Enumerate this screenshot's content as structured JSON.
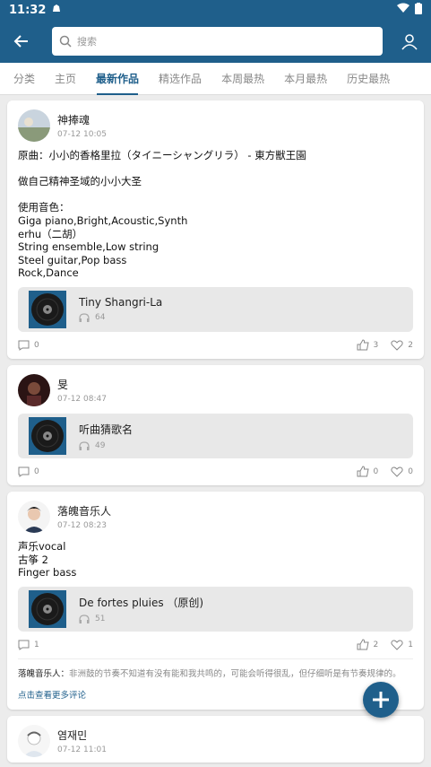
{
  "status": {
    "time": "11:32"
  },
  "search": {
    "placeholder": "搜索"
  },
  "tabs": [
    {
      "label": "分类"
    },
    {
      "label": "主页"
    },
    {
      "label": "最新作品",
      "active": true
    },
    {
      "label": "精选作品"
    },
    {
      "label": "本周最热"
    },
    {
      "label": "本月最热"
    },
    {
      "label": "历史最热"
    }
  ],
  "posts": [
    {
      "user": "神捧魂",
      "date": "07-12 10:05",
      "text": "原曲：小小的香格里拉（タイニーシャングリラ） - 東方獣王園\n\n做自己精神圣域的小小大圣\n\n使用音色：\nGiga piano,Bright,Acoustic,Synth\nerhu（二胡）\nString ensemble,Low string\nSteel guitar,Pop bass\nRock,Dance",
      "track": {
        "title": "Tiny Shangri-La",
        "plays": "64"
      },
      "comments": "0",
      "likes": "3",
      "favs": "2"
    },
    {
      "user": "旻",
      "date": "07-12 08:47",
      "text": "",
      "track": {
        "title": "听曲猜歌名",
        "plays": "49"
      },
      "comments": "0",
      "likes": "0",
      "favs": "0"
    },
    {
      "user": "落魄音乐人",
      "date": "07-12 08:23",
      "text": "声乐vocal\n古筝 2\nFinger bass",
      "track": {
        "title": "De fortes pluies （原创)",
        "plays": "51"
      },
      "comments": "1",
      "likes": "2",
      "favs": "1",
      "comment_preview": {
        "author": "落魄音乐人：",
        "text": "非洲鼓的节奏不知道有没有能和我共鸣的，可能会听得很乱，但仔细听是有节奏规律的。"
      },
      "more_comments": "点击查看更多评论"
    },
    {
      "user": "염재민",
      "date": "07-12 11:01"
    }
  ],
  "colors": {
    "primary": "#1f5f8b",
    "background": "#ececec"
  }
}
